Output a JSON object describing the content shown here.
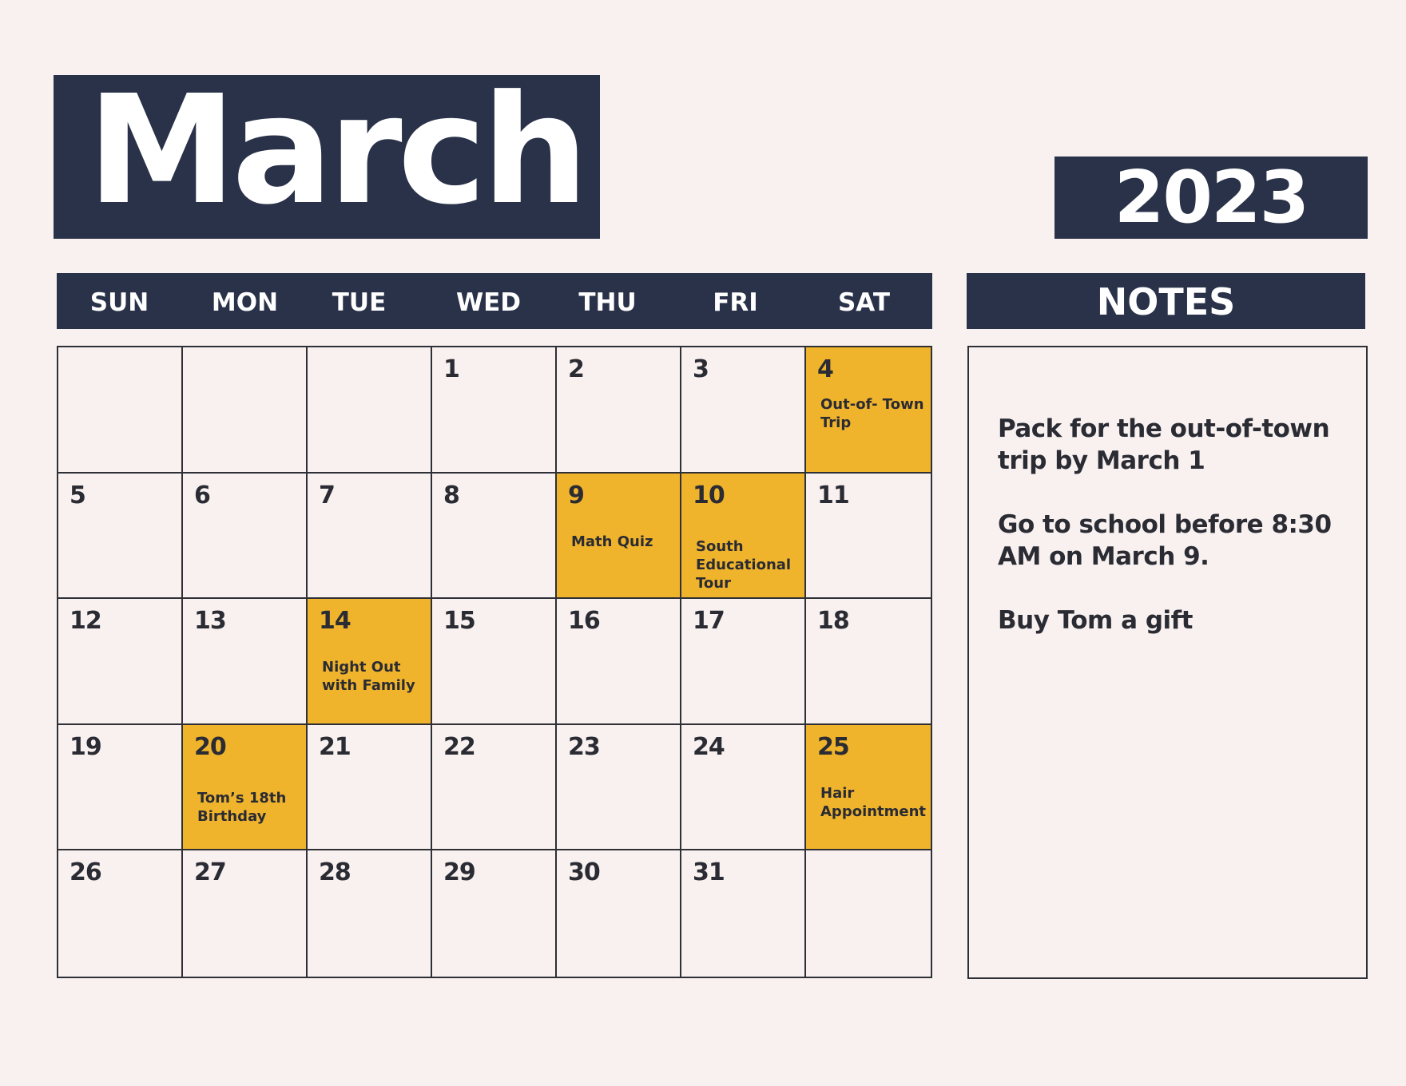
{
  "header": {
    "month": "March",
    "year": "2023"
  },
  "weekdays": [
    "SUN",
    "MON",
    "TUE",
    "WED",
    "THU",
    "FRI",
    "SAT"
  ],
  "colors": {
    "navy": "#293249",
    "highlight": "#f0b42c",
    "background": "#f8f1f0",
    "text": "#2a2b33"
  },
  "cells": [
    {
      "day": "",
      "event": "",
      "highlight": false
    },
    {
      "day": "",
      "event": "",
      "highlight": false
    },
    {
      "day": "",
      "event": "",
      "highlight": false
    },
    {
      "day": "1",
      "event": "",
      "highlight": false
    },
    {
      "day": "2",
      "event": "",
      "highlight": false
    },
    {
      "day": "3",
      "event": "",
      "highlight": false
    },
    {
      "day": "4",
      "event": "Out-of- Town Trip",
      "highlight": true
    },
    {
      "day": "5",
      "event": "",
      "highlight": false
    },
    {
      "day": "6",
      "event": "",
      "highlight": false
    },
    {
      "day": "7",
      "event": "",
      "highlight": false
    },
    {
      "day": "8",
      "event": "",
      "highlight": false
    },
    {
      "day": "9",
      "event": "Math Quiz",
      "highlight": true
    },
    {
      "day": "10",
      "event": "South Educational Tour",
      "highlight": true
    },
    {
      "day": "11",
      "event": "",
      "highlight": false
    },
    {
      "day": "12",
      "event": "",
      "highlight": false
    },
    {
      "day": "13",
      "event": "",
      "highlight": false
    },
    {
      "day": "14",
      "event": "Night Out with Family",
      "highlight": true
    },
    {
      "day": "15",
      "event": "",
      "highlight": false
    },
    {
      "day": "16",
      "event": "",
      "highlight": false
    },
    {
      "day": "17",
      "event": "",
      "highlight": false
    },
    {
      "day": "18",
      "event": "",
      "highlight": false
    },
    {
      "day": "19",
      "event": "",
      "highlight": false
    },
    {
      "day": "20",
      "event": "Tom’s 18th Birthday",
      "highlight": true
    },
    {
      "day": "21",
      "event": "",
      "highlight": false
    },
    {
      "day": "22",
      "event": "",
      "highlight": false
    },
    {
      "day": "23",
      "event": "",
      "highlight": false
    },
    {
      "day": "24",
      "event": "",
      "highlight": false
    },
    {
      "day": "25",
      "event": "Hair Appointment",
      "highlight": true
    },
    {
      "day": "26",
      "event": "",
      "highlight": false
    },
    {
      "day": "27",
      "event": "",
      "highlight": false
    },
    {
      "day": "28",
      "event": "",
      "highlight": false
    },
    {
      "day": "29",
      "event": "",
      "highlight": false
    },
    {
      "day": "30",
      "event": "",
      "highlight": false
    },
    {
      "day": "31",
      "event": "",
      "highlight": false
    },
    {
      "day": "",
      "event": "",
      "highlight": false
    }
  ],
  "notes": {
    "title": "NOTES",
    "items": [
      "Pack for the out-of-town trip by March 1",
      "Go to school before 8:30 AM on March 9.",
      "Buy Tom a gift"
    ]
  }
}
